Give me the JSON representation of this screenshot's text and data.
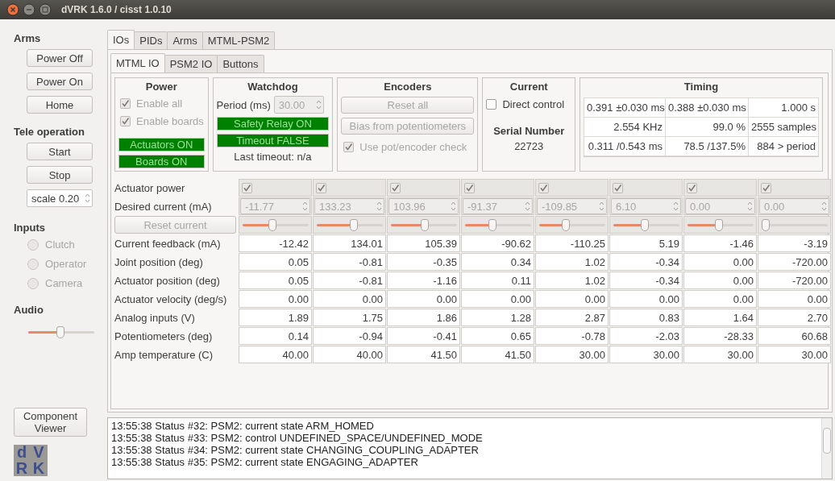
{
  "window": {
    "title": "dVRK 1.6.0 / cisst 1.0.10"
  },
  "arms": {
    "heading": "Arms",
    "buttons": [
      "Power Off",
      "Power On",
      "Home"
    ]
  },
  "tele_operation": {
    "heading": "Tele operation",
    "buttons": [
      "Start",
      "Stop"
    ],
    "scale": "scale 0.20"
  },
  "inputs": {
    "heading": "Inputs",
    "items": [
      {
        "label": "Clutch",
        "selected": false
      },
      {
        "label": "Operator",
        "selected": false
      },
      {
        "label": "Camera",
        "selected": false
      }
    ]
  },
  "audio": {
    "heading": "Audio",
    "level": 0.48
  },
  "component_viewer": "Component Viewer",
  "logo": {
    "letters": [
      "d",
      "V",
      "R",
      "K"
    ]
  },
  "tabs": [
    {
      "label": "IOs",
      "selected": true
    },
    {
      "label": "PIDs",
      "selected": false
    },
    {
      "label": "Arms",
      "selected": false
    },
    {
      "label": "MTML-PSM2",
      "selected": false
    }
  ],
  "subtabs": [
    {
      "label": "MTML IO",
      "selected": true
    },
    {
      "label": "PSM2 IO",
      "selected": false
    },
    {
      "label": "Buttons",
      "selected": false
    }
  ],
  "power": {
    "title": "Power",
    "checks": [
      {
        "label": "Enable all",
        "checked": true
      },
      {
        "label": "Enable boards",
        "checked": true
      }
    ],
    "indicators": [
      {
        "label": "Actuators ON",
        "on": true
      },
      {
        "label": "Boards ON",
        "on": true
      }
    ]
  },
  "watchdog": {
    "title": "Watchdog",
    "period_label": "Period (ms)",
    "period_value": "30.00",
    "indicators": [
      {
        "label": "Safety Relay ON",
        "on": true
      },
      {
        "label": "Timeout FALSE",
        "on": true
      }
    ],
    "last_timeout": "Last timeout: n/a"
  },
  "encoders": {
    "title": "Encoders",
    "buttons": [
      {
        "label": "Reset all",
        "disabled": true
      },
      {
        "label": "Bias from potentiometers",
        "disabled": true
      }
    ],
    "check": {
      "label": "Use pot/encoder check",
      "checked": true
    }
  },
  "current": {
    "title": "Current",
    "check": {
      "label": "Direct control",
      "checked": false
    },
    "serial_title": "Serial Number",
    "serial": "22723"
  },
  "timing": {
    "title": "Timing",
    "rows": [
      [
        "0.391 ±0.030 ms",
        "0.388 ±0.030 ms",
        "1.000 s"
      ],
      [
        "2.554  KHz",
        "99.0 %",
        "2555 samples"
      ],
      [
        "0.311 /0.543 ms",
        "78.5 /137.5%",
        "884 > period"
      ]
    ]
  },
  "table": {
    "actuator_power": {
      "label": "Actuator power",
      "values": [
        {
          "checked": true
        },
        {
          "checked": true
        },
        {
          "checked": true
        },
        {
          "checked": true
        },
        {
          "checked": true
        },
        {
          "checked": true
        },
        {
          "checked": true
        },
        {
          "checked": true
        }
      ]
    },
    "desired_current": {
      "label": "Desired current (mA)",
      "values": [
        "-11.77",
        "133.23",
        "103.96",
        "-91.37",
        "-109.85",
        "6.10",
        "0.00",
        "0.00"
      ]
    },
    "reset_button": "Reset current",
    "sliders": [
      {
        "level": 0.45
      },
      {
        "level": 0.58
      },
      {
        "level": 0.52
      },
      {
        "level": 0.41
      },
      {
        "level": 0.4
      },
      {
        "level": 0.48
      },
      {
        "level": 0.48
      },
      {
        "level": 0
      }
    ],
    "rows": [
      {
        "label": "Current feedback (mA)",
        "values": [
          "-12.42",
          "134.01",
          "105.39",
          "-90.62",
          "-110.25",
          "5.19",
          "-1.46",
          "-3.19"
        ]
      },
      {
        "label": "Joint position (deg)",
        "values": [
          "0.05",
          "-0.81",
          "-0.35",
          "0.34",
          "1.02",
          "-0.34",
          "0.00",
          "-720.00"
        ]
      },
      {
        "label": "Actuator position (deg)",
        "values": [
          "0.05",
          "-0.81",
          "-1.16",
          "0.11",
          "1.02",
          "-0.34",
          "0.00",
          "-720.00"
        ]
      },
      {
        "label": "Actuator velocity (deg/s)",
        "values": [
          "0.00",
          "0.00",
          "0.00",
          "0.00",
          "0.00",
          "0.00",
          "0.00",
          "0.00"
        ]
      },
      {
        "label": "Analog inputs (V)",
        "values": [
          "1.89",
          "1.75",
          "1.86",
          "1.28",
          "2.87",
          "0.83",
          "1.64",
          "2.70"
        ]
      },
      {
        "label": "Potentiometers (deg)",
        "values": [
          "0.14",
          "-0.94",
          "-0.41",
          "0.65",
          "-0.78",
          "-2.03",
          "-28.33",
          "60.68"
        ]
      },
      {
        "label": "Amp temperature (C)",
        "values": [
          "40.00",
          "40.00",
          "41.50",
          "41.50",
          "30.00",
          "30.00",
          "30.00",
          "30.00"
        ]
      }
    ]
  },
  "log": {
    "lines": [
      "13:55:38 Status #32: PSM2: current state ARM_HOMED",
      "13:55:38 Status #33: PSM2: control UNDEFINED_SPACE/UNDEFINED_MODE",
      "13:55:38 Status #34: PSM2: current state CHANGING_COUPLING_ADAPTER",
      "13:55:38 Status #35: PSM2: current state ENGAGING_ADAPTER"
    ]
  }
}
